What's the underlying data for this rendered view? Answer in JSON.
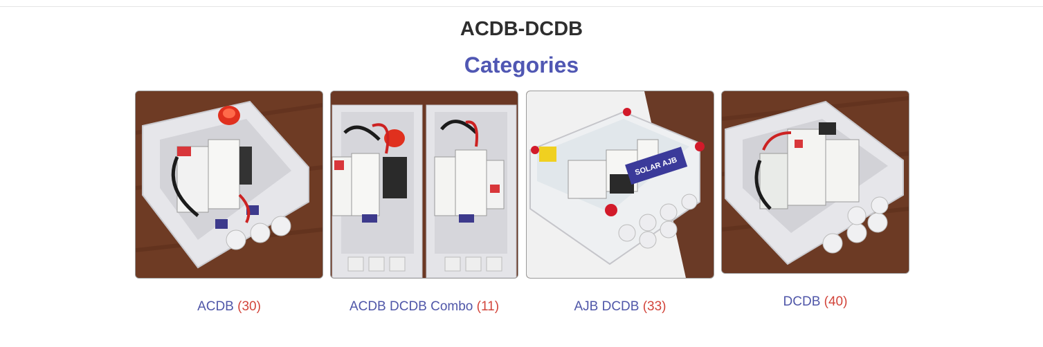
{
  "page": {
    "title": "ACDB-DCDB",
    "section_title": "Categories"
  },
  "categories": [
    {
      "name": "ACDB",
      "count": "(30)",
      "image_icon": "acdb-box-image"
    },
    {
      "name": "ACDB DCDB Combo",
      "count": "(11)",
      "image_icon": "acdb-dcdb-combo-box-image"
    },
    {
      "name": "AJB DCDB",
      "count": "(33)",
      "image_icon": "ajb-dcdb-box-image",
      "image_text": "SOLAR AJB"
    },
    {
      "name": "DCDB",
      "count": "(40)",
      "image_icon": "dcdb-box-image"
    }
  ],
  "colors": {
    "title": "#2e2e2e",
    "accent": "#5057b3",
    "count": "#d2443a",
    "wood": "#6b3a25",
    "enclosure": "#e9e9ec"
  }
}
